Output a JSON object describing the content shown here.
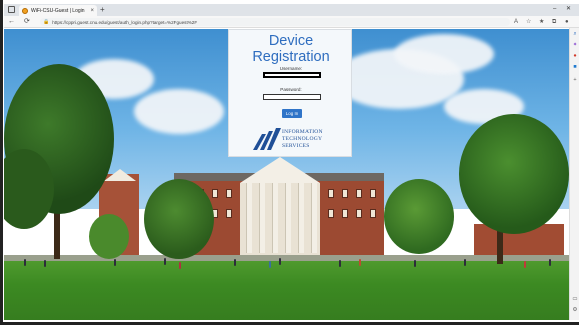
{
  "browser": {
    "tab_title": "WiFi-CSU-Guest | Login",
    "new_tab": "+",
    "close_tab": "×",
    "url": "https://cppri.guest.cnu.edu/guest/auth_login.php?target=%2Fguest%2F",
    "win_minimize": "–",
    "win_close": "✕"
  },
  "login": {
    "title": "Device Registration",
    "username_label": "Username:",
    "username_value": "",
    "password_label": "Password:",
    "password_value": "",
    "submit_label": "Log In"
  },
  "logo": {
    "line1": "INFORMATION",
    "line2": "TECHNOLOGY",
    "line3": "SERVICES",
    "color": "#1f4f97"
  },
  "colors": {
    "title_blue": "#2e6dbf",
    "button_blue": "#2f74c8"
  }
}
